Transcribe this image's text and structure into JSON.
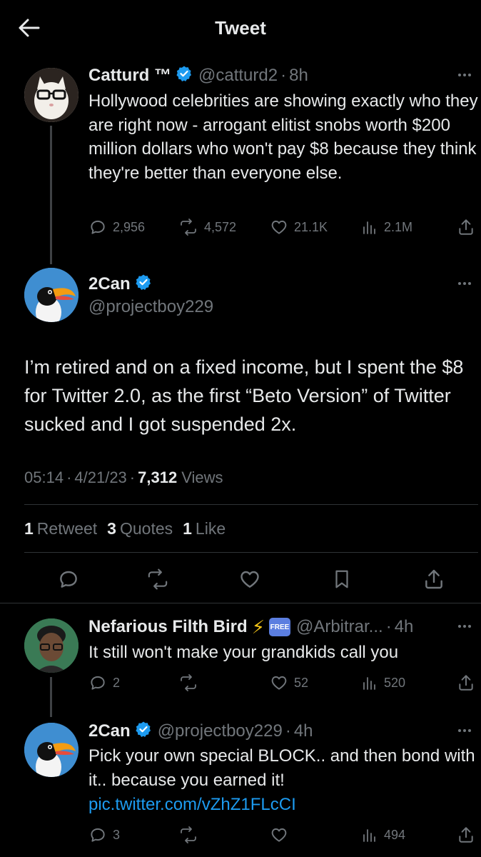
{
  "header": {
    "title": "Tweet"
  },
  "tweet1": {
    "name": "Catturd ™",
    "handle": "@catturd2",
    "time": "8h",
    "text": "Hollywood celebrities are showing exactly who they are right now - arrogant elitist snobs worth $200 million dollars who won't pay  $8 because they think they're better than everyone else.",
    "replies": "2,956",
    "retweets": "4,572",
    "likes": "21.1K",
    "views": "2.1M"
  },
  "main_tweet": {
    "name": "2Can",
    "handle": "@projectboy229",
    "text": "I’m retired and on a fixed income, but I spent the $8 for Twitter 2.0, as the first “Beto Version” of Twitter sucked and I got suspended 2x.",
    "time": "05:14",
    "date": "4/21/23",
    "views_count": "7,312",
    "views_label": "Views",
    "retweets_count": "1",
    "retweets_label": "Retweet",
    "quotes_count": "3",
    "quotes_label": "Quotes",
    "likes_count": "1",
    "likes_label": "Like"
  },
  "reply1": {
    "name": "Nefarious Filth Bird",
    "emoji": "⚡",
    "badge": "FREE",
    "handle": "@Arbitrar...",
    "time": "4h",
    "text": "It still won't make your grandkids call you",
    "replies": "2",
    "retweets": "",
    "likes": "52",
    "views": "520"
  },
  "reply2": {
    "name": "2Can",
    "handle": "@projectboy229",
    "time": "4h",
    "text": "Pick your own special BLOCK.. and then bond with it.. because you earned it!",
    "link": "pic.twitter.com/vZhZ1FLcCI",
    "replies": "3",
    "retweets": "",
    "likes": "",
    "views": "494"
  },
  "separator": "·",
  "colors": {
    "background": "#000000",
    "text": "#e7e9ea",
    "muted": "#71767b",
    "accent": "#1d9bf0",
    "divider": "#2f3336"
  }
}
